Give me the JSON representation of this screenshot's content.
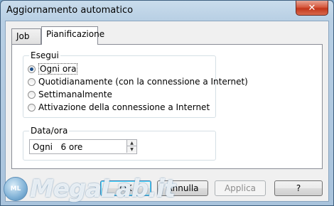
{
  "window": {
    "title": "Aggiornamento automatico",
    "close_glyph": "✕"
  },
  "tabs": [
    {
      "label": "Job",
      "active": false
    },
    {
      "label": "Pianificazione",
      "active": true
    }
  ],
  "esegui": {
    "legend": "Esegui",
    "options": [
      {
        "label": "Ogni ora",
        "checked": true
      },
      {
        "label": "Quotidianamente (con la connessione a Internet)",
        "checked": false
      },
      {
        "label": "Settimanalmente",
        "checked": false
      },
      {
        "label": "Attivazione della connessione a Internet",
        "checked": false
      }
    ]
  },
  "dataora": {
    "legend": "Data/ora",
    "value": "Ogni   6 ore",
    "up_icon": "▲",
    "down_icon": "▼"
  },
  "buttons": {
    "ok": "OK",
    "cancel": "Annulla",
    "apply": "Applica",
    "help": "?"
  },
  "watermark": {
    "logo_text": "ML",
    "text": "MegaLab.it"
  },
  "colors": {
    "accent": "#1c4f8a",
    "close": "#c2361b",
    "frame": "#a9c3dc"
  }
}
